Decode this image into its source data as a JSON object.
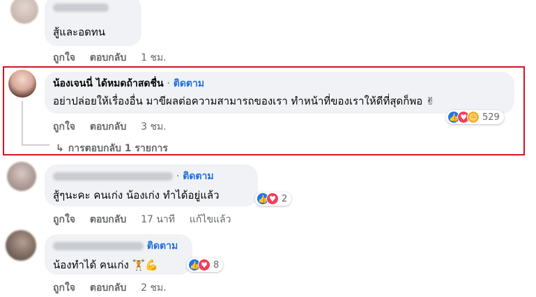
{
  "comments": [
    {
      "text": "สู้และอดทน",
      "actions": {
        "like": "ถูกใจ",
        "reply": "ตอบกลับ",
        "time": "1 ชม."
      }
    },
    {
      "name": "น้องเจนนี่ ได้หมดถ้าสดชื่น",
      "separator": "·",
      "follow": "ติดตาม",
      "text": "อย่าปล่อยให้เรื่องอื่น มาขีผลต่อความสามารถของเรา ทำหน้าที่ของเราให้ดีที่สุดก็พอ ✌",
      "actions": {
        "like": "ถูกใจ",
        "reply": "ตอบกลับ",
        "time": "3 ชม."
      },
      "reactions": {
        "count": "529",
        "icons": [
          "like-icon",
          "love-icon",
          "care-icon"
        ]
      },
      "replies_link": "การตอบกลับ 1 รายการ"
    },
    {
      "separator": "·",
      "follow": "ติดตาม",
      "text": "สู้ๆนะคะ คนเก่ง น้องเก่ง ทำได้อยู่แล้ว",
      "actions": {
        "like": "ถูกใจ",
        "reply": "ตอบกลับ",
        "time": "17 นาที",
        "edited": "แก้ไขแล้ว"
      },
      "reactions": {
        "count": "2",
        "icons": [
          "like-icon",
          "love-icon"
        ]
      }
    },
    {
      "follow": "ติดตาม",
      "text": "น้องทำได้ คนเก่ง 🏋💪",
      "actions": {
        "like": "ถูกใจ",
        "reply": "ตอบกลับ",
        "time": "2 ชม."
      },
      "reactions": {
        "count": "8",
        "icons": [
          "like-icon",
          "love-icon"
        ]
      }
    }
  ],
  "colors": {
    "highlight": "#d3141f",
    "follow": "#216fdb",
    "bubble": "#f0f2f5",
    "like": "#1877f2",
    "love": "#f33e58"
  }
}
